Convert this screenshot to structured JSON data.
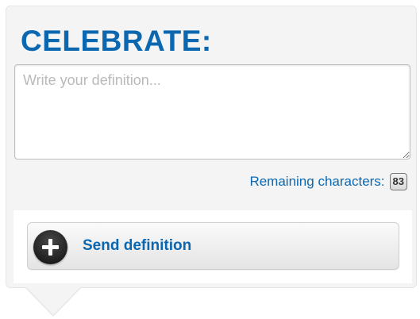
{
  "form": {
    "title": "CELEBRATE:",
    "definition_value": "",
    "definition_placeholder": "Write your definition...",
    "remaining_label": "Remaining characters:",
    "remaining_count": "83",
    "send_label": "Send definition"
  },
  "icons": {
    "send_button_icon": "plus-circle-icon"
  },
  "colors": {
    "accent": "#0b67b0",
    "panel_background": "#f4f4f4",
    "icon_dark": "#2a2a2a"
  }
}
